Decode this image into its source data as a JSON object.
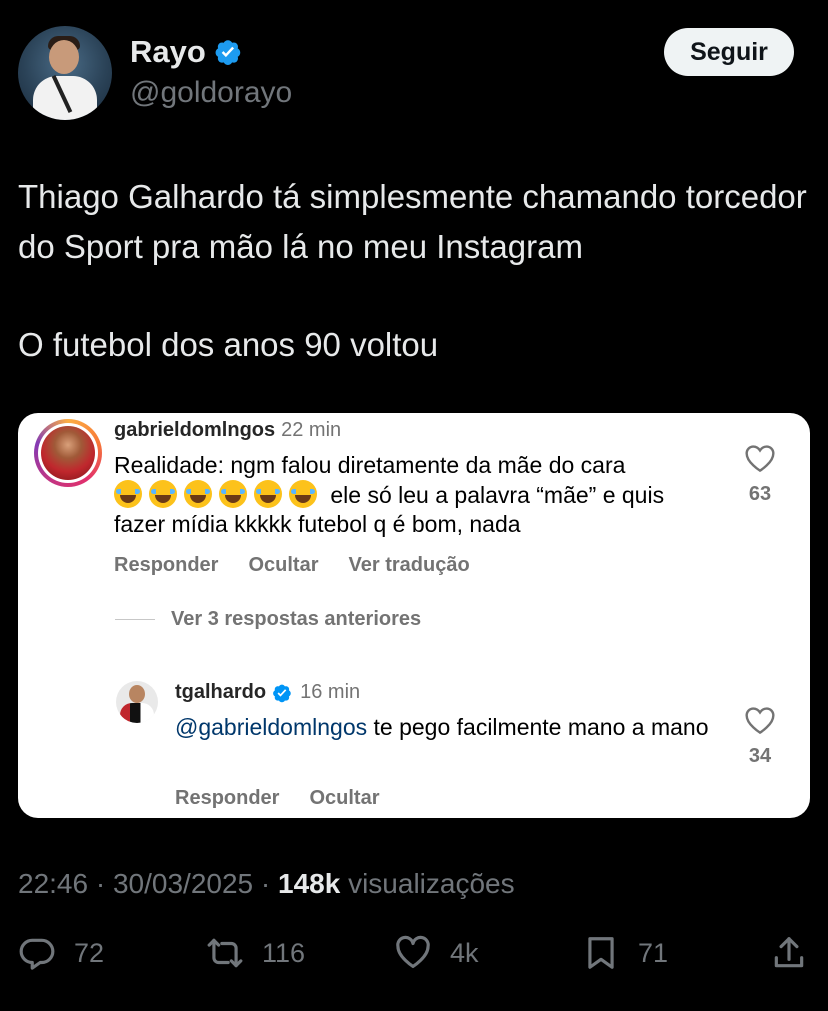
{
  "tweet": {
    "author": {
      "name": "Rayo",
      "handle": "@goldorayo",
      "verified": true
    },
    "follow_label": "Seguir",
    "paragraphs": [
      "Thiago Galhardo tá simplesmente chamando torcedor do Sport pra mão lá no meu Instagram",
      "O futebol dos anos 90 voltou"
    ],
    "time": "22:46",
    "date": "30/03/2025",
    "views_count": "148k",
    "views_label": "visualizações",
    "separator": " · ",
    "stats": {
      "replies": "72",
      "retweets": "116",
      "likes": "4k",
      "bookmarks": "71"
    }
  },
  "instagram_screenshot": {
    "comment": {
      "username": "gabrieldomlngos",
      "time": "22 min",
      "text_before_emojis": "Realidade: ngm falou diretamente da mãe do cara",
      "emoji_count": 6,
      "text_after_emojis": "ele só leu a palavra “mãe” e quis fazer mídia kkkkk futebol q é bom, nada",
      "likes": "63",
      "actions": [
        "Responder",
        "Ocultar",
        "Ver tradução"
      ]
    },
    "view_replies_label": "Ver 3 respostas anteriores",
    "reply": {
      "username": "tgalhardo",
      "verified": true,
      "time": "16 min",
      "mention": "@gabrieldomlngos",
      "text": "te pego facilmente mano a mano",
      "likes": "34",
      "actions": [
        "Responder",
        "Ocultar"
      ]
    }
  },
  "colors": {
    "background": "#000000",
    "verified_blue": "#1d9bf0",
    "muted": "#71767b",
    "ig_mention": "#00376b"
  }
}
